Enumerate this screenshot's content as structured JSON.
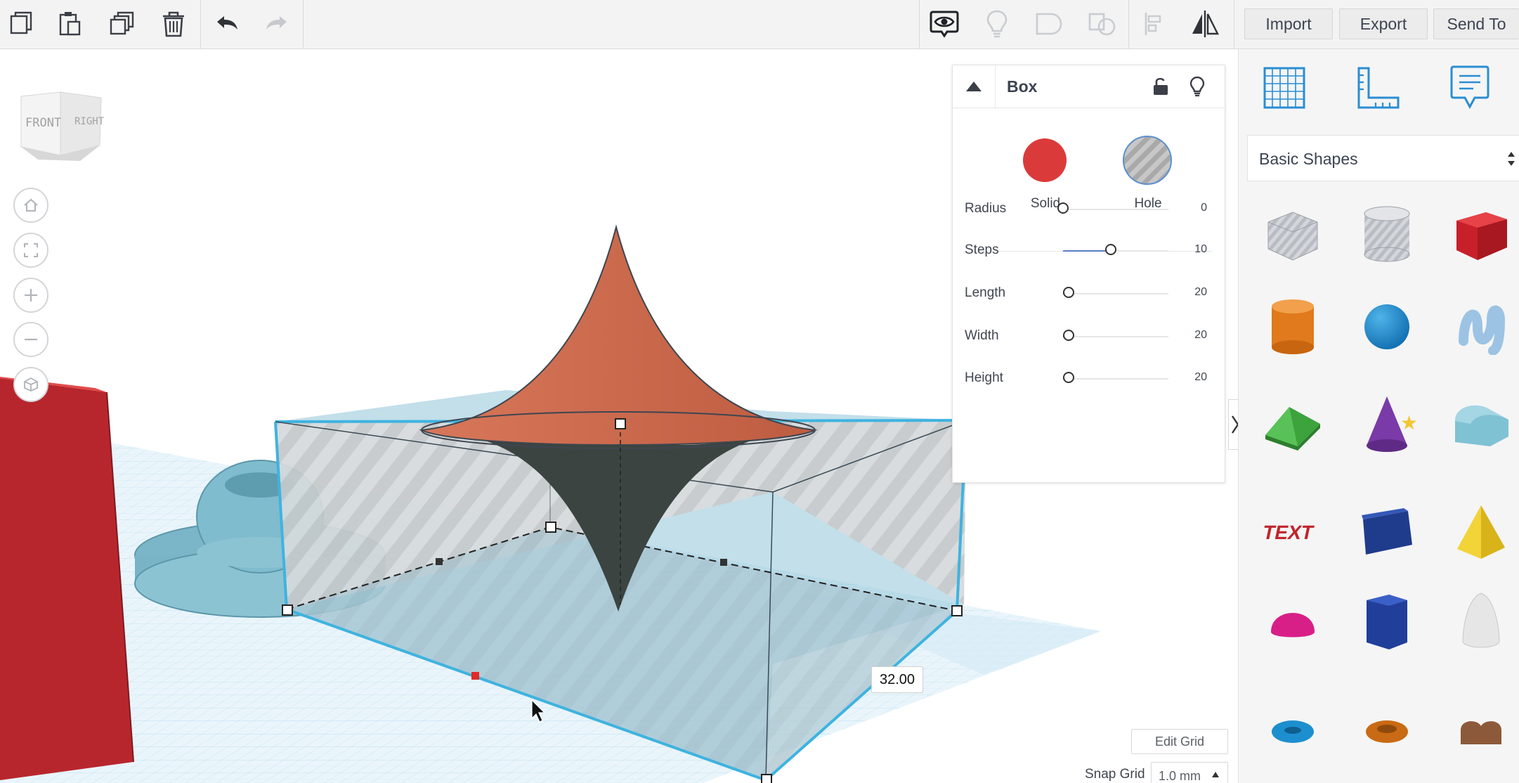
{
  "toolbar": {
    "left_tools": [
      {
        "name": "copy",
        "icon": "copy-icon",
        "enabled": true
      },
      {
        "name": "paste",
        "icon": "paste-icon",
        "enabled": true
      },
      {
        "name": "duplicate",
        "icon": "duplicate-icon",
        "enabled": true
      },
      {
        "name": "delete",
        "icon": "trash-icon",
        "enabled": true
      },
      {
        "name": "undo",
        "icon": "undo-icon",
        "enabled": true
      },
      {
        "name": "redo",
        "icon": "redo-icon",
        "enabled": false
      }
    ],
    "right_tools": [
      {
        "name": "show-all",
        "icon": "eye-speech-icon",
        "enabled": true
      },
      {
        "name": "lightbulb",
        "icon": "lightbulb-icon",
        "enabled": false
      },
      {
        "name": "group",
        "icon": "group-icon",
        "enabled": false
      },
      {
        "name": "ungroup",
        "icon": "ungroup-icon",
        "enabled": false
      },
      {
        "name": "align",
        "icon": "align-icon",
        "enabled": false
      },
      {
        "name": "mirror",
        "icon": "mirror-icon",
        "enabled": true
      }
    ],
    "import_label": "Import",
    "export_label": "Export",
    "send_to_label": "Send To"
  },
  "viewcube": {
    "front": "FRONT",
    "right": "RIGHT"
  },
  "nav_controls": [
    {
      "name": "home",
      "icon": "home-icon"
    },
    {
      "name": "fit",
      "icon": "fit-view-icon"
    },
    {
      "name": "zoom-in",
      "icon": "plus-icon"
    },
    {
      "name": "zoom-out",
      "icon": "minus-icon"
    },
    {
      "name": "ortho",
      "icon": "perspective-cube-icon"
    }
  ],
  "inspector": {
    "title": "Box",
    "solid_label": "Solid",
    "hole_label": "Hole",
    "solid_color": "#db3a3a",
    "properties": [
      {
        "label": "Radius",
        "value": "0",
        "fraction": 0.0
      },
      {
        "label": "Steps",
        "value": "10",
        "fraction": 0.45
      },
      {
        "label": "Length",
        "value": "20",
        "fraction": 0.05
      },
      {
        "label": "Width",
        "value": "20",
        "fraction": 0.05
      },
      {
        "label": "Height",
        "value": "20",
        "fraction": 0.05
      }
    ]
  },
  "dimension_readout": "32.00",
  "grid_controls": {
    "edit_grid_label": "Edit Grid",
    "snap_grid_label": "Snap Grid",
    "snap_grid_value": "1.0 mm"
  },
  "sidebar": {
    "top_icons": [
      {
        "name": "workplane",
        "icon": "grid-icon"
      },
      {
        "name": "ruler",
        "icon": "ruler-icon"
      },
      {
        "name": "notes",
        "icon": "note-icon"
      }
    ],
    "library_select": "Basic Shapes",
    "shapes": [
      {
        "name": "box-hole",
        "icon": "box-hole-icon"
      },
      {
        "name": "cylinder-hole",
        "icon": "cylinder-hole-icon"
      },
      {
        "name": "box",
        "icon": "box-icon"
      },
      {
        "name": "cylinder",
        "icon": "cylinder-icon"
      },
      {
        "name": "sphere",
        "icon": "sphere-icon"
      },
      {
        "name": "scribble",
        "icon": "scribble-icon"
      },
      {
        "name": "roof",
        "icon": "roof-icon"
      },
      {
        "name": "cone",
        "icon": "cone-icon"
      },
      {
        "name": "round-roof",
        "icon": "round-roof-icon"
      },
      {
        "name": "text",
        "icon": "text-shape-icon"
      },
      {
        "name": "wedge",
        "icon": "wedge-icon"
      },
      {
        "name": "pyramid",
        "icon": "pyramid-icon"
      },
      {
        "name": "half-sphere",
        "icon": "half-sphere-icon"
      },
      {
        "name": "polygon",
        "icon": "polygon-icon"
      },
      {
        "name": "paraboloid",
        "icon": "paraboloid-icon"
      },
      {
        "name": "torus",
        "icon": "torus-icon"
      },
      {
        "name": "tube",
        "icon": "tube-icon"
      },
      {
        "name": "heart",
        "icon": "heart-icon"
      }
    ]
  }
}
